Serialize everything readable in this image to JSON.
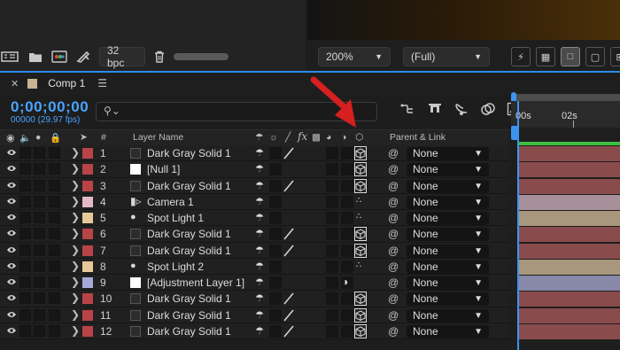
{
  "toolbar": {
    "bpc": "32 bpc",
    "zoom": "200%",
    "resolution": "(Full)"
  },
  "comp": {
    "tab_title": "Comp 1",
    "timecode": "0;00;00;00",
    "fps": "00000 (29.97 fps)",
    "search_placeholder": ""
  },
  "columns": {
    "number": "#",
    "layer_name": "Layer Name",
    "fx": "fx",
    "parent": "Parent & Link"
  },
  "timeline": {
    "marker_0": "00s",
    "marker_2": "02s"
  },
  "layers": [
    {
      "num": "1",
      "name": "Dark Gray Solid 1",
      "label": "#b84447",
      "type": "solid",
      "bar": "#8a4b4d"
    },
    {
      "num": "2",
      "name": "[Null 1]",
      "label": "#b84447",
      "type": "null",
      "bar": "#8a4b4d"
    },
    {
      "num": "3",
      "name": "Dark Gray Solid 1",
      "label": "#b84447",
      "type": "solid",
      "bar": "#8a4b4d"
    },
    {
      "num": "4",
      "name": "Camera 1",
      "label": "#e4b8c8",
      "type": "camera",
      "bar": "#a8909a"
    },
    {
      "num": "5",
      "name": "Spot Light 1",
      "label": "#e8c89a",
      "type": "light",
      "bar": "#a8977c"
    },
    {
      "num": "6",
      "name": "Dark Gray Solid 1",
      "label": "#b84447",
      "type": "solid",
      "bar": "#8a4b4d"
    },
    {
      "num": "7",
      "name": "Dark Gray Solid 1",
      "label": "#b84447",
      "type": "solid",
      "bar": "#8a4b4d"
    },
    {
      "num": "8",
      "name": "Spot Light 2",
      "label": "#e8c89a",
      "type": "light",
      "bar": "#a8977c"
    },
    {
      "num": "9",
      "name": "[Adjustment Layer 1]",
      "label": "#a8a8d8",
      "type": "adjustment",
      "bar": "#8888a8"
    },
    {
      "num": "10",
      "name": "Dark Gray Solid 1",
      "label": "#b84447",
      "type": "solid",
      "bar": "#8a4b4d"
    },
    {
      "num": "11",
      "name": "Dark Gray Solid 1",
      "label": "#b84447",
      "type": "solid",
      "bar": "#8a4b4d"
    },
    {
      "num": "12",
      "name": "Dark Gray Solid 1",
      "label": "#b84447",
      "type": "solid",
      "bar": "#8a4b4d"
    }
  ],
  "parent_value": "None",
  "colors": {
    "accent_blue": "#2d8ceb",
    "timecode_blue": "#4aa3ff",
    "arrow_red": "#d61f1f",
    "work_area_green": "#3fbf3f"
  }
}
